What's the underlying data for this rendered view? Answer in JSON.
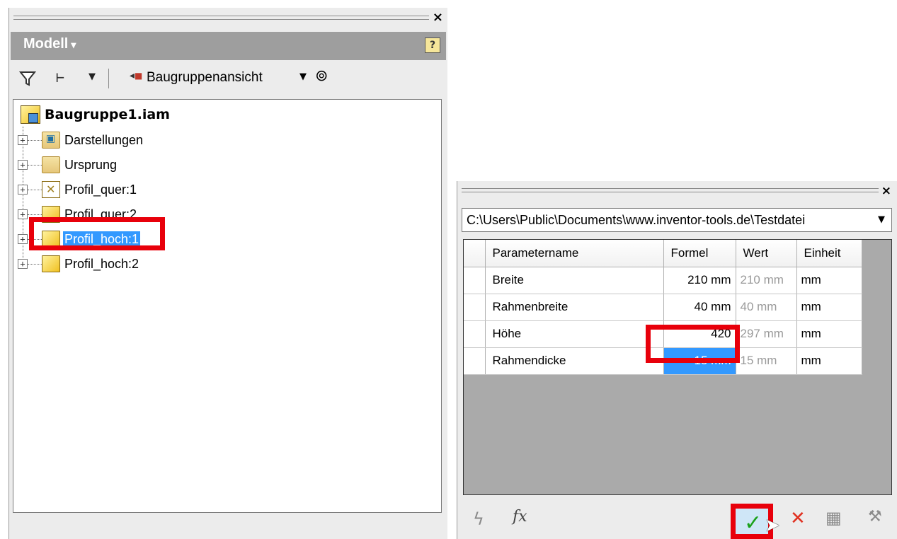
{
  "browser": {
    "title": "Modell",
    "title_caret": "▾",
    "help_label": "?",
    "close_label": "×",
    "toolbar": {
      "view_label": "Baugruppenansicht"
    },
    "tree": {
      "root": "Baugruppe1.iam",
      "nodes": [
        {
          "label": "Darstellungen",
          "icon": "representations-folder-icon"
        },
        {
          "label": "Ursprung",
          "icon": "origin-folder-icon"
        },
        {
          "label": "Profil_quer:1",
          "icon": "part-wireframe-icon"
        },
        {
          "label": "Profil_quer:2",
          "icon": "part-icon"
        },
        {
          "label": "Profil_hoch:1",
          "icon": "part-icon",
          "selected": true
        },
        {
          "label": "Profil_hoch:2",
          "icon": "part-icon"
        }
      ]
    }
  },
  "parameters": {
    "close_label": "×",
    "path": "C:\\Users\\Public\\Documents\\www.inventor-tools.de\\Testdatei",
    "columns": [
      "Parametername",
      "Formel",
      "Wert",
      "Einheit"
    ],
    "rows": [
      {
        "name": "Breite",
        "formel": "210 mm",
        "wert": "210 mm",
        "einheit": "mm"
      },
      {
        "name": "Rahmenbreite",
        "formel": "40 mm",
        "wert": "40 mm",
        "einheit": "mm"
      },
      {
        "name": "Höhe",
        "formel": "420",
        "wert": "297 mm",
        "einheit": "mm"
      },
      {
        "name": "Rahmendicke",
        "formel": "15 mm",
        "wert": "15 mm",
        "einheit": "mm",
        "selected": true
      }
    ]
  },
  "colors": {
    "highlight": "#e8000b",
    "selection": "#3399ff",
    "header_bg": "#9e9e9e"
  }
}
